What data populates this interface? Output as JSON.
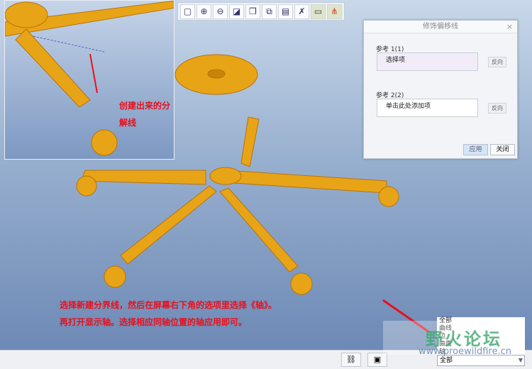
{
  "toolbar": {
    "icons": [
      "zoom-fit-icon",
      "zoom-in-icon",
      "zoom-out-icon",
      "repaint-icon",
      "shading-icon",
      "saved-views-icon",
      "layers-icon",
      "datum-display-icon",
      "annotation-icon",
      "spin-center-icon"
    ]
  },
  "dialog": {
    "title": "修饰偏移线",
    "close": "×",
    "ref1_label": "参考 1(1)",
    "ref1_value": "选择项",
    "ref2_label": "参考 2(2)",
    "ref2_value": "单击此处添加项",
    "flip_label": "反向",
    "apply": "应用",
    "close_btn": "关闭"
  },
  "annotations": {
    "inset_note": "创建出来的分解线",
    "main_note": "选择新建分界线，然后在屏幕右下角的选项里选择《轴》。再打开显示轴。选择相应同轴位置的轴应用即可。"
  },
  "filter": {
    "options": [
      "全部",
      "曲线",
      "边",
      "曲面",
      "轴"
    ],
    "selected": "全部"
  },
  "watermark": {
    "text": "野火论坛",
    "url": "www.proewildfire.cn"
  },
  "colors": {
    "model": "#e8a010",
    "annotation": "#e8101c"
  }
}
